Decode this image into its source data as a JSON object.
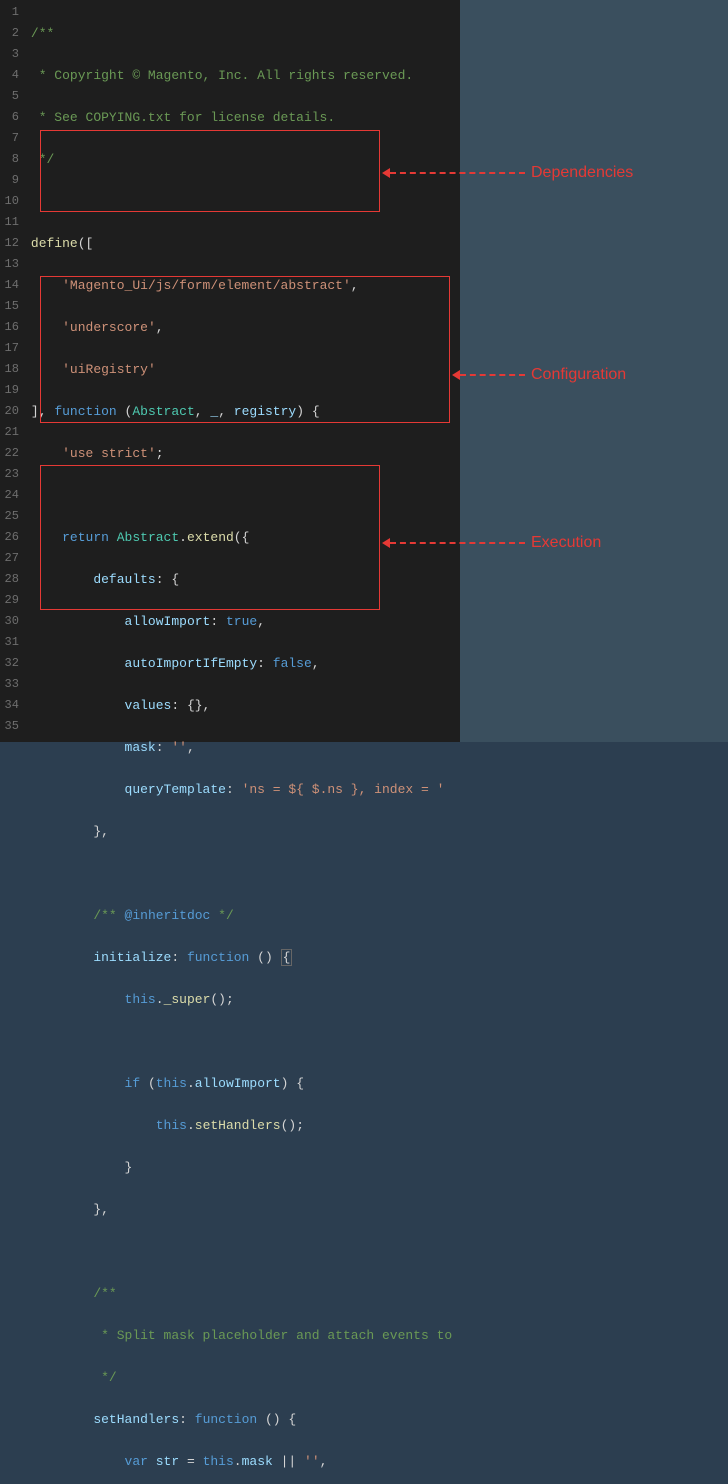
{
  "annotations": {
    "dependencies": "Dependencies",
    "configuration": "Configuration",
    "execution": "Execution"
  },
  "code": {
    "l1": "/**",
    "l2": " * Copyright © Magento, Inc. All rights reserved.",
    "l3": " * See COPYING.txt for license details.",
    "l4": " */",
    "l5": "",
    "l6_define": "define",
    "l6_punc": "([",
    "l7_str": "'Magento_Ui/js/form/element/abstract'",
    "l7_c": ",",
    "l8_str": "'underscore'",
    "l8_c": ",",
    "l9_str": "'uiRegistry'",
    "l10_br": "], ",
    "l10_fn": "function",
    "l10_args_op": " (",
    "l10_a1": "Abstract",
    "l10_a2": "_",
    "l10_a3": "registry",
    "l10_args_cl": ") {",
    "l11": "'use strict'",
    "l11_s": ";",
    "l13_ret": "return",
    "l13_cls": "Abstract",
    "l13_dot": ".",
    "l13_ext": "extend",
    "l13_p": "({",
    "l14_key": "defaults",
    "l14_p": ": {",
    "l15_key": "allowImport",
    "l15_p": ": ",
    "l15_v": "true",
    "l15_c": ",",
    "l16_key": "autoImportIfEmpty",
    "l16_p": ": ",
    "l16_v": "false",
    "l16_c": ",",
    "l17_key": "values",
    "l17_p": ": {},",
    "l18_key": "mask",
    "l18_p": ": ",
    "l18_v": "''",
    "l18_c": ",",
    "l19_key": "queryTemplate",
    "l19_p": ": ",
    "l19_v": "'ns = ${ $.ns }, index = '",
    "l20": "},",
    "l22_a": "/** ",
    "l22_b": "@inheritdoc",
    "l22_c": " */",
    "l23_key": "initialize",
    "l23_p": ": ",
    "l23_fn": "function",
    "l23_args": " () ",
    "l23_br": "{",
    "l24_this": "this",
    "l24_d": ".",
    "l24_m": "_super",
    "l24_p": "();",
    "l26_if": "if",
    "l26_p1": " (",
    "l26_this": "this",
    "l26_d": ".",
    "l26_prop": "allowImport",
    "l26_p2": ") {",
    "l27_this": "this",
    "l27_d": ".",
    "l27_m": "setHandlers",
    "l27_p": "();",
    "l28": "}",
    "l29": "},",
    "l31": "/**",
    "l32": " * Split mask placeholder and attach events to ",
    "l33": " */",
    "l34_key": "setHandlers",
    "l34_p": ": ",
    "l34_fn": "function",
    "l34_args": " () {",
    "l35_var": "var",
    "l35_id": "str",
    "l35_eq": " = ",
    "l35_this": "this",
    "l35_d": ".",
    "l35_prop": "mask",
    "l35_or": " || ",
    "l35_str": "''",
    "l35_c": ","
  },
  "line_numbers": [
    "1",
    "2",
    "3",
    "4",
    "5",
    "6",
    "7",
    "8",
    "9",
    "10",
    "11",
    "12",
    "13",
    "14",
    "15",
    "16",
    "17",
    "18",
    "19",
    "20",
    "21",
    "22",
    "23",
    "24",
    "25",
    "26",
    "27",
    "28",
    "29",
    "30",
    "31",
    "32",
    "33",
    "34",
    "35"
  ]
}
